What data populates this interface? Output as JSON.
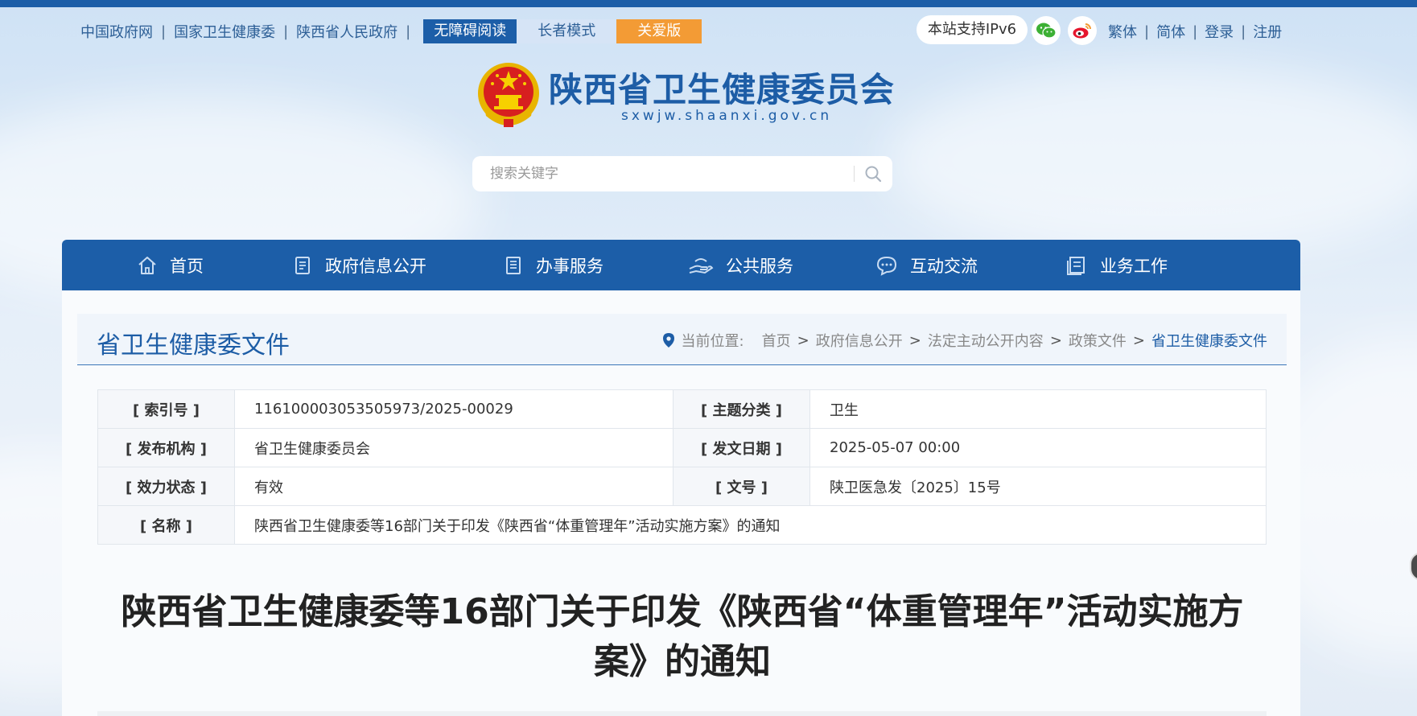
{
  "top_links": [
    "中国政府网",
    "国家卫生健康委",
    "陕西省人民政府"
  ],
  "mode_buttons": {
    "accessible": "无障碍阅读",
    "elder": "长者模式",
    "care": "关爱版"
  },
  "ipv6": "本站支持IPv6",
  "right_links": [
    "繁体",
    "简体",
    "登录",
    "注册"
  ],
  "site": {
    "title": "陕西省卫生健康委员会",
    "domain": "sxwjw.shaanxi.gov.cn"
  },
  "search": {
    "placeholder": "搜索关键字"
  },
  "nav": [
    {
      "label": "首页",
      "icon": "home-icon"
    },
    {
      "label": "政府信息公开",
      "icon": "document-list-icon"
    },
    {
      "label": "办事服务",
      "icon": "form-icon"
    },
    {
      "label": "公共服务",
      "icon": "hand-service-icon"
    },
    {
      "label": "互动交流",
      "icon": "chat-icon"
    },
    {
      "label": "业务工作",
      "icon": "book-icon"
    }
  ],
  "section": {
    "title": "省卫生健康委文件",
    "location_label": "当前位置:",
    "breadcrumb": [
      "首页",
      "政府信息公开",
      "法定主动公开内容",
      "政策文件",
      "省卫生健康委文件"
    ]
  },
  "meta": {
    "index_label": "[ 索引号 ]",
    "index_value": "116100003053505973/2025-00029",
    "topic_label": "[ 主题分类 ]",
    "topic_value": "卫生",
    "publisher_label": "[ 发布机构 ]",
    "publisher_value": "省卫生健康委员会",
    "date_label": "[ 发文日期 ]",
    "date_value": "2025-05-07 00:00",
    "status_label": "[ 效力状态 ]",
    "status_value": "有效",
    "docno_label": "[ 文号 ]",
    "docno_value": "陕卫医急发〔2025〕15号",
    "name_label": "[ 名称 ]",
    "name_value": "陕西省卫生健康委等16部门关于印发《陕西省“体重管理年”活动实施方案》的通知"
  },
  "doc_title": "陕西省卫生健康委等16部门关于印发《陕西省“体重管理年”活动实施方案》的通知",
  "colors": {
    "primary": "#1c5ea8",
    "care": "#f39b35",
    "valid": "#14962a"
  }
}
